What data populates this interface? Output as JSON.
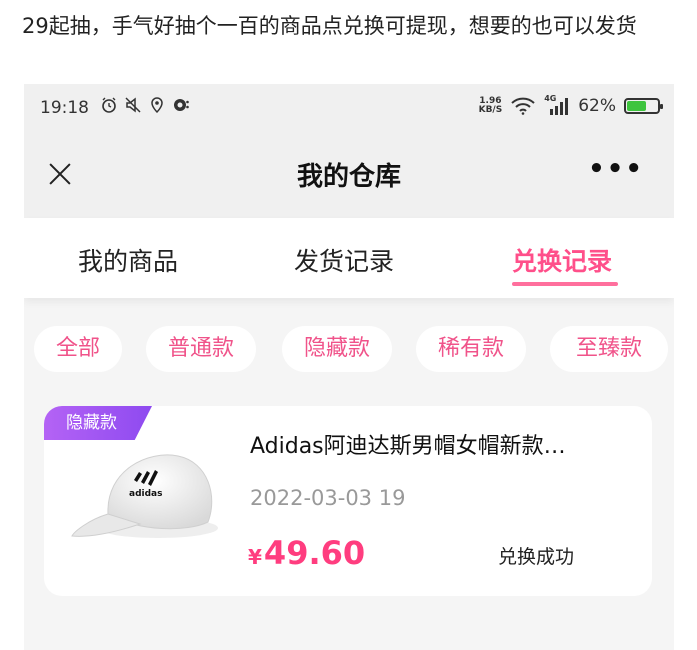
{
  "caption": "29起抽，手气好抽个一百的商品点兑换可提现，想要的也可以发货",
  "statusbar": {
    "time": "19:18",
    "net_speed_top": "1.96",
    "net_speed_bottom": "KB/S",
    "signal_label": "4G",
    "battery": "62%",
    "battery_level": 0.62,
    "icons_left": [
      "alarm-icon",
      "mute-icon",
      "location-icon",
      "app-notification-icon"
    ]
  },
  "nav": {
    "title": "我的仓库",
    "close_icon": "close-icon",
    "more": "•••"
  },
  "tabs": [
    {
      "label": "我的商品",
      "active": false
    },
    {
      "label": "发货记录",
      "active": false
    },
    {
      "label": "兑换记录",
      "active": true
    }
  ],
  "filters": [
    "全部",
    "普通款",
    "隐藏款",
    "稀有款",
    "至臻款"
  ],
  "record": {
    "badge": "隐藏款",
    "name": "Adidas阿迪达斯男帽女帽新款…",
    "date": "2022-03-03 19",
    "currency": "¥",
    "price": "49.60",
    "status": "兑换成功",
    "image": "white-adidas-cap",
    "image_logo_text": "adidas"
  },
  "colors": {
    "accent": "#ff4f8a",
    "badge_gradient": [
      "#b463f5",
      "#8e4af0"
    ],
    "page_bg": "#f5f5f5"
  }
}
